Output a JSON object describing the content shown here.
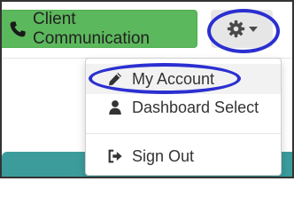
{
  "header": {
    "client_communication_label": "Client Communication",
    "client_communication_icon": "phone-icon",
    "settings_icon": "gear-icon",
    "settings_caret_icon": "caret-down-icon"
  },
  "dropdown": {
    "items": [
      {
        "label": "My Account",
        "icon": "pencil-icon"
      },
      {
        "label": "Dashboard Select",
        "icon": "user-icon"
      },
      {
        "label": "Sign Out",
        "icon": "sign-out-icon"
      }
    ]
  },
  "colors": {
    "client_button": "#5cb85c",
    "settings_button": "#e6e6e6",
    "annotation_outline": "#2b2fd0",
    "bottom_bar": "#3c9c9c"
  }
}
